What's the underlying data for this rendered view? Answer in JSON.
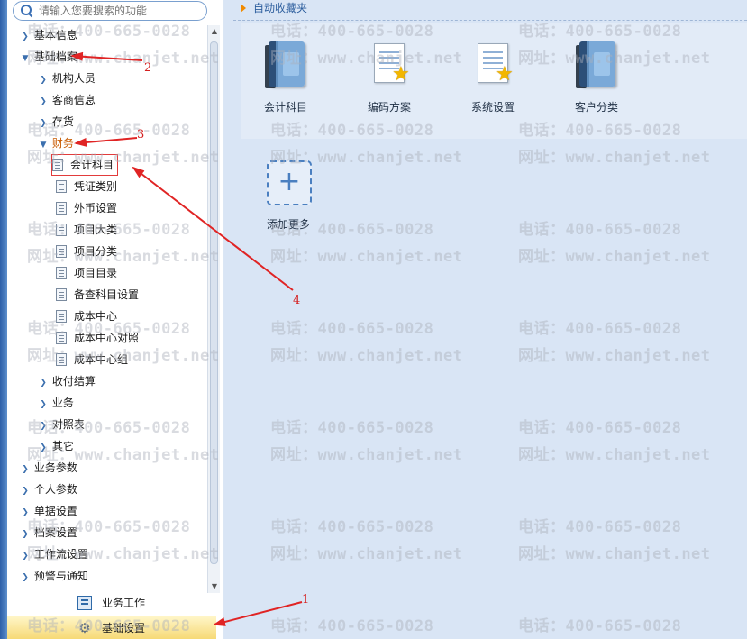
{
  "search": {
    "placeholder": "请输入您要搜索的功能"
  },
  "tree": [
    {
      "label": "基本信息",
      "expanded": false,
      "level": 0
    },
    {
      "label": "基础档案",
      "expanded": true,
      "level": 0
    },
    {
      "label": "机构人员",
      "expanded": false,
      "level": 1
    },
    {
      "label": "客商信息",
      "expanded": false,
      "level": 1
    },
    {
      "label": "存货",
      "expanded": false,
      "level": 1
    },
    {
      "label": "财务",
      "expanded": true,
      "level": 1
    },
    {
      "label": "会计科目",
      "leaf": true,
      "level": 2
    },
    {
      "label": "凭证类别",
      "leaf": true,
      "level": 2
    },
    {
      "label": "外币设置",
      "leaf": true,
      "level": 2
    },
    {
      "label": "项目大类",
      "leaf": true,
      "level": 2
    },
    {
      "label": "项目分类",
      "leaf": true,
      "level": 2
    },
    {
      "label": "项目目录",
      "leaf": true,
      "level": 2
    },
    {
      "label": "备查科目设置",
      "leaf": true,
      "level": 2
    },
    {
      "label": "成本中心",
      "leaf": true,
      "level": 2
    },
    {
      "label": "成本中心对照",
      "leaf": true,
      "level": 2
    },
    {
      "label": "成本中心组",
      "leaf": true,
      "level": 2
    },
    {
      "label": "收付结算",
      "expanded": false,
      "level": 1
    },
    {
      "label": "业务",
      "expanded": false,
      "level": 1
    },
    {
      "label": "对照表",
      "expanded": false,
      "level": 1
    },
    {
      "label": "其它",
      "expanded": false,
      "level": 1
    },
    {
      "label": "业务参数",
      "expanded": false,
      "level": 0
    },
    {
      "label": "个人参数",
      "expanded": false,
      "level": 0
    },
    {
      "label": "单据设置",
      "expanded": false,
      "level": 0
    },
    {
      "label": "档案设置",
      "expanded": false,
      "level": 0
    },
    {
      "label": "工作流设置",
      "expanded": false,
      "level": 0
    },
    {
      "label": "预警与通知",
      "expanded": false,
      "level": 0
    }
  ],
  "bottom_tabs": {
    "work": "业务工作",
    "basic": "基础设置"
  },
  "favorites": {
    "header": "自动收藏夹",
    "apps": [
      {
        "label": "会计科目",
        "icon": "book-icon"
      },
      {
        "label": "编码方案",
        "icon": "doc-star-icon"
      },
      {
        "label": "系统设置",
        "icon": "doc-star-icon"
      },
      {
        "label": "客户分类",
        "icon": "book-icon"
      }
    ],
    "add_label": "添加更多"
  },
  "watermark": {
    "phone": "电话：400-665-0028",
    "site": "网址：www.chanjet.net"
  },
  "annotations": [
    "1",
    "2",
    "3",
    "4"
  ],
  "colors": {
    "accent": "#2e5f9e",
    "annotation": "#d42020",
    "selected_tab": "#f6d873"
  }
}
